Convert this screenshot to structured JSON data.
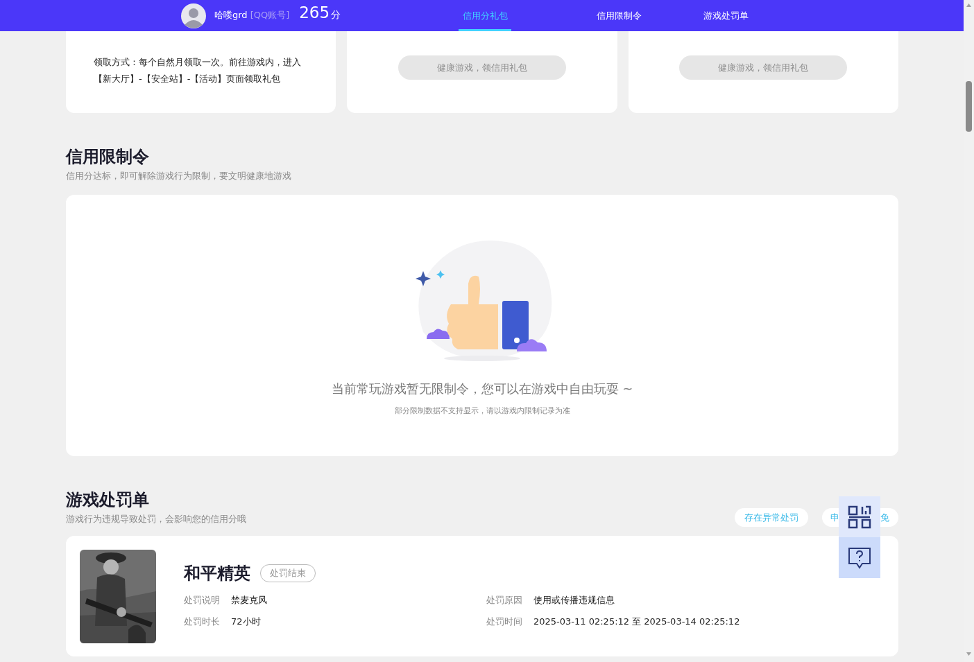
{
  "header": {
    "username": "哈喽grd",
    "account_type": "[QQ账号]",
    "score": "265",
    "score_unit": "分",
    "tabs": [
      {
        "label": "信用分礼包",
        "selected": true
      },
      {
        "label": "信用限制令",
        "selected": false
      },
      {
        "label": "游戏处罚单",
        "selected": false
      }
    ]
  },
  "gift_cards": [
    {
      "kind": "text",
      "text": "领取方式：每个自然月领取一次。前往游戏内，进入【新大厅】-【安全站】-【活动】页面领取礼包"
    },
    {
      "kind": "button",
      "button": "健康游戏，领信用礼包",
      "disabled": true
    },
    {
      "kind": "button",
      "button": "健康游戏，领信用礼包",
      "disabled": true
    }
  ],
  "restriction": {
    "title": "信用限制令",
    "subtitle": "信用分达标，即可解除游戏行为限制，要文明健康地游戏",
    "empty_message": "当前常玩游戏暂无限制令，您可以在游戏中自由玩耍 ~",
    "empty_note": "部分限制数据不支持显示，请以游戏内限制记录为准"
  },
  "penalties": {
    "title": "游戏处罚单",
    "subtitle": "游戏行为违规导致处罚，会影响您的信用分哦",
    "actions": [
      {
        "kind": "full",
        "label": "存在异常处罚"
      },
      {
        "kind": "covered",
        "label_start": "申",
        "label_end": "免"
      }
    ],
    "items": [
      {
        "game": "和平精英",
        "status": "处罚结束",
        "fields": [
          {
            "label": "处罚说明",
            "value": "禁麦克风"
          },
          {
            "label": "处罚原因",
            "value": "使用或传播违规信息"
          },
          {
            "label": "处罚时长",
            "value": "72小时"
          },
          {
            "label": "处罚时间",
            "value": "2025-03-11 02:25:12 至 2025-03-14 02:25:12"
          }
        ]
      }
    ]
  }
}
